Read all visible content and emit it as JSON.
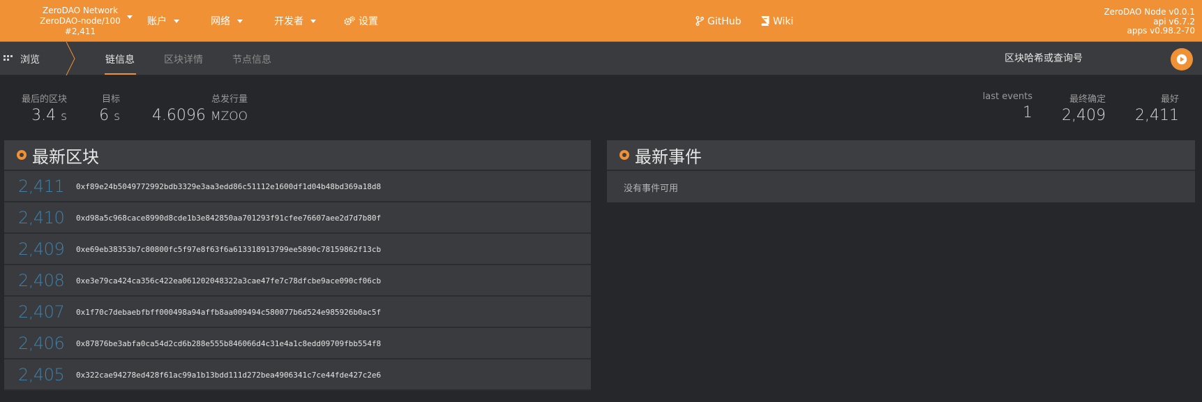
{
  "header": {
    "network_name": "ZeroDAO Network",
    "node_name": "ZeroDAO-node/100",
    "block": "#2,411",
    "nav": [
      {
        "label": "账户",
        "has_caret": true
      },
      {
        "label": "网络",
        "has_caret": true
      },
      {
        "label": "开发者",
        "has_caret": true
      },
      {
        "label": "设置",
        "icon": "gear-icon"
      }
    ],
    "links": [
      {
        "label": "GitHub",
        "icon": "git-branch-icon"
      },
      {
        "label": "Wiki",
        "icon": "book-icon"
      }
    ],
    "versions": [
      "ZeroDAO Node v0.0.1",
      "api v6.7.2",
      "apps v0.98.2-70"
    ]
  },
  "subnav": {
    "browse_label": "浏览",
    "tabs": [
      {
        "label": "链信息",
        "active": true
      },
      {
        "label": "区块详情",
        "active": false
      },
      {
        "label": "节点信息",
        "active": false
      }
    ],
    "search_placeholder": "区块哈希或查询号"
  },
  "summary": {
    "last_block": {
      "label": "最后的区块",
      "value": "3.4",
      "unit": "s"
    },
    "target": {
      "label": "目标",
      "value": "6",
      "unit": "s"
    },
    "total_issuance": {
      "label": "总发行量",
      "value": "4.6096",
      "unit": "MZOO"
    },
    "last_events": {
      "label": "last events",
      "value": "1"
    },
    "finalized": {
      "label": "最终确定",
      "value": "2,409"
    },
    "best": {
      "label": "最好",
      "value": "2,411"
    }
  },
  "recent_blocks": {
    "title": "最新区块",
    "rows": [
      {
        "number": "2,411",
        "hash": "0xf89e24b5049772992bdb3329e3aa3edd86c51112e1600df1d04b48bd369a18d8"
      },
      {
        "number": "2,410",
        "hash": "0xd98a5c968cace8990d8cde1b3e842850aa701293f91cfee76607aee2d7d7b80f"
      },
      {
        "number": "2,409",
        "hash": "0xe69eb38353b7c80800fc5f97e8f63f6a613318913799ee5890c78159862f13cb"
      },
      {
        "number": "2,408",
        "hash": "0xe3e79ca424ca356c422ea061202048322a3cae47fe7c78dfcbe9ace090cf06cb"
      },
      {
        "number": "2,407",
        "hash": "0x1f70c7debaebfbff000498a94affb8aa009494c580077b6d524e985926b0ac5f"
      },
      {
        "number": "2,406",
        "hash": "0x87876be3abfa0ca54d2cd6b288e555b846066d4c31e4a1c8edd09709fbb554f8"
      },
      {
        "number": "2,405",
        "hash": "0x322cae94278ed428f61ac99a1b13bdd111d272bea4906341c7ce44fde427c2e6"
      }
    ]
  },
  "recent_events": {
    "title": "最新事件",
    "empty_text": "没有事件可用"
  },
  "colors": {
    "accent": "#f19135",
    "background": "#26272b",
    "panel": "#3a3b3e",
    "block_number": "#3f7fa8"
  }
}
